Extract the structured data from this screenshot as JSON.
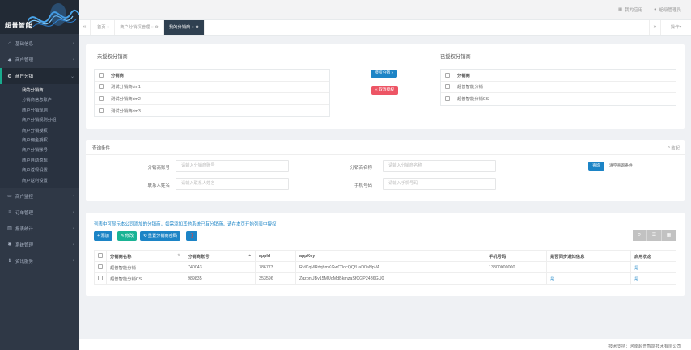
{
  "app": {
    "name": "超普智能"
  },
  "sidebar": {
    "items": [
      {
        "label": "基础信息",
        "icon": "home-icon"
      },
      {
        "label": "商户管理",
        "icon": "diamond-icon"
      },
      {
        "label": "商户分销",
        "icon": "gear-icon"
      }
    ],
    "sub_items": [
      "我的分销商",
      "分销商信息账户",
      "商户分销规则",
      "商户分销规则分组",
      "商户分销授权",
      "商户佣金授权",
      "商户分销账号",
      "商户自动返现",
      "商户返现设置",
      "商户返利设置"
    ],
    "items_after": [
      {
        "label": "商户监控",
        "icon": "monitor-icon"
      },
      {
        "label": "订单管理",
        "icon": "list-icon"
      },
      {
        "label": "报表统计",
        "icon": "chart-icon"
      },
      {
        "label": "系统管理",
        "icon": "cog-icon"
      },
      {
        "label": "资讯服务",
        "icon": "info-icon"
      }
    ]
  },
  "topbar": {
    "apps": "我的应用",
    "user": "超级管理员"
  },
  "tabs": {
    "items": [
      "首页 ◌",
      "商户分销权管理 ◌ ⊗",
      "我的分销商 ◌ ⊗"
    ],
    "ops": "操作▾"
  },
  "authorize": {
    "left_title": "未授权分销商",
    "right_title": "已授权分销商",
    "col_header": "分销商",
    "unauthorized": [
      "测试分销商dm1",
      "测试分销商dm2",
      "测试分销商dm3"
    ],
    "authorized": [
      "超普智能分销",
      "超普智能分销CS"
    ],
    "grant_button": "授权分销 »",
    "revoke_button": "« 取消授权"
  },
  "query": {
    "title": "查询条件",
    "collapse": "^ 收起",
    "fields": [
      {
        "label": "分销商账号",
        "placeholder": "请输入分销商账号"
      },
      {
        "label": "分销商名称",
        "placeholder": "请输入分销商名称"
      },
      {
        "label": "联系人姓名",
        "placeholder": "请输入联系人姓名"
      },
      {
        "label": "手机号码",
        "placeholder": "请输入手机号码"
      }
    ],
    "search_button": "查询",
    "reset_button": "清空查询条件"
  },
  "results": {
    "notice": "列表中可显示本公司添加的分销商，如需添加其他系统已有分销商，请在本页开始列表中授权",
    "buttons": {
      "add": "+ 添加",
      "edit": "✎ 修改",
      "reset_pwd": "⟲ 重置分销商密码",
      "help": "❓"
    },
    "columns": [
      "分销商名称",
      "分销商账号",
      "appId",
      "appKey",
      "手机号码",
      "是否同步通知信息",
      "启用状态"
    ],
    "rows": [
      [
        "超普智能分销",
        "740043",
        "786773",
        "RvlCqMRdqhmKGwC0dcQQfUaD0aNpVA",
        "13800000000",
        "",
        "是"
      ],
      [
        "超普智能分销CS",
        "989835",
        "353596",
        "ZqzpnUBy15MUgMdBkmzaSfCGP2436GU0",
        "",
        "是",
        "是"
      ]
    ]
  },
  "footer": {
    "text": "技术支持：河南超普智能技术有限公司"
  }
}
